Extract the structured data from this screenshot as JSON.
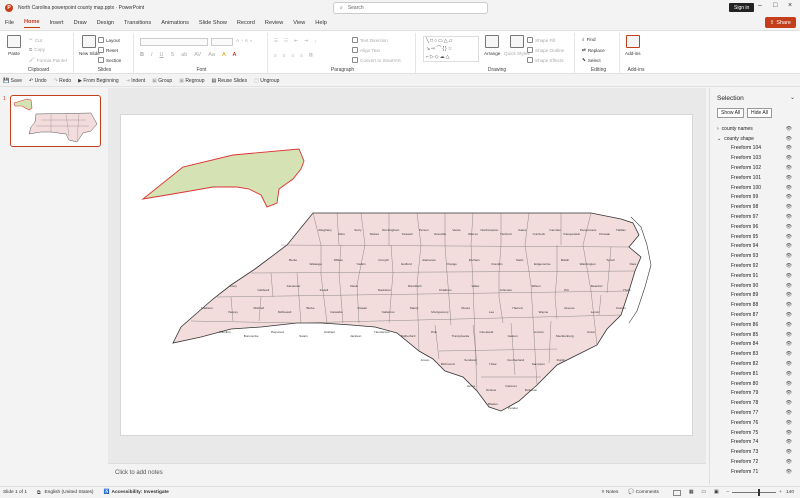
{
  "titlebar": {
    "doc_title": "North Carolina powerpoint county map.pptx  ·  PowerPoint",
    "search_placeholder": "Search",
    "signin": "Sign in"
  },
  "menu": {
    "items": [
      "File",
      "Home",
      "Insert",
      "Draw",
      "Design",
      "Transitions",
      "Animations",
      "Slide Show",
      "Record",
      "Review",
      "View",
      "Help"
    ],
    "share": "Share"
  },
  "ribbon": {
    "clipboard": {
      "label": "Clipboard",
      "paste": "Paste",
      "cut": "Cut",
      "copy": "Copy",
      "format_painter": "Format Painter"
    },
    "slides": {
      "label": "Slides",
      "new_slide": "New Slide",
      "layout": "Layout",
      "reset": "Reset",
      "section": "Section"
    },
    "font": {
      "label": "Font"
    },
    "paragraph": {
      "label": "Paragraph",
      "text_direction": "Text Direction",
      "align_text": "Align Text",
      "smartart": "Convert to SmartArt"
    },
    "drawing": {
      "label": "Drawing",
      "arrange": "Arrange",
      "quick_styles": "Quick Styles",
      "shape_fill": "Shape Fill",
      "shape_outline": "Shape Outline",
      "shape_effects": "Shape Effects"
    },
    "editing": {
      "label": "Editing",
      "find": "Find",
      "replace": "Replace",
      "select": "Select"
    },
    "addins": {
      "label": "Add-ins",
      "addins": "Add-ins"
    }
  },
  "qat": {
    "save": "Save",
    "undo": "Undo",
    "redo": "Redo",
    "from_beginning": "From Beginning",
    "indent": "Indent",
    "group": "Group",
    "regroup": "Regroup",
    "reuse": "Reuse Slides",
    "ungroup": "Ungroup"
  },
  "thumbs": {
    "num": "1"
  },
  "notes": {
    "placeholder": "Click to add notes"
  },
  "selection": {
    "title": "Selection",
    "show_all": "Show All",
    "hide_all": "Hide All",
    "groups": [
      "county names",
      "county shape"
    ],
    "items": [
      "Freeform 104",
      "Freeform 103",
      "Freeform 102",
      "Freeform 101",
      "Freeform 100",
      "Freeform 99",
      "Freeform 98",
      "Freeform 97",
      "Freeform 96",
      "Freeform 95",
      "Freeform 94",
      "Freeform 93",
      "Freeform 92",
      "Freeform 91",
      "Freeform 90",
      "Freeform 89",
      "Freeform 88",
      "Freeform 87",
      "Freeform 86",
      "Freeform 85",
      "Freeform 84",
      "Freeform 83",
      "Freeform 82",
      "Freeform 81",
      "Freeform 80",
      "Freeform 79",
      "Freeform 78",
      "Freeform 77",
      "Freeform 76",
      "Freeform 75",
      "Freeform 74",
      "Freeform 73",
      "Freeform 72",
      "Freeform 71"
    ]
  },
  "status": {
    "slide": "Slide 1 of 1",
    "language": "English (United States)",
    "accessibility": "Accessibility: Investigate",
    "notes": "Notes",
    "comments": "Comments",
    "zoom": "140"
  },
  "colors": {
    "accent": "#c43e1c",
    "county_fill": "#f2dcdc",
    "inset_fill": "#d4e2b4"
  },
  "counties": [
    "Alleghany",
    "Ashe",
    "Surry",
    "Stokes",
    "Rockingham",
    "Caswell",
    "Person",
    "Granville",
    "Vance",
    "Warren",
    "Northampton",
    "Hertford",
    "Gates",
    "Currituck",
    "Camden",
    "Pasquotank",
    "Perquimans",
    "Chowan",
    "Halifax",
    "Bertie",
    "Watauga",
    "Wilkes",
    "Yadkin",
    "Forsyth",
    "Guilford",
    "Alamance",
    "Orange",
    "Durham",
    "Franklin",
    "Nash",
    "Edgecombe",
    "Martin",
    "Washington",
    "Tyrrell",
    "Dare",
    "Avery",
    "Caldwell",
    "Alexander",
    "Iredell",
    "Davie",
    "Davidson",
    "Randolph",
    "Chatham",
    "Wake",
    "Johnston",
    "Wilson",
    "Pitt",
    "Beaufort",
    "Hyde",
    "Madison",
    "Yancey",
    "Mitchell",
    "McDowell",
    "Burke",
    "Catawba",
    "Rowan",
    "Cabarrus",
    "Stanly",
    "Montgomery",
    "Moore",
    "Lee",
    "Harnett",
    "Wayne",
    "Greene",
    "Lenoir",
    "Craven",
    "Pamlico",
    "Buncombe",
    "Haywood",
    "Swain",
    "Graham",
    "Jackson",
    "Henderson",
    "Rutherford",
    "Polk",
    "Transylvania",
    "Cleveland",
    "Gaston",
    "Lincoln",
    "Mecklenburg",
    "Union",
    "Anson",
    "Richmond",
    "Scotland",
    "Hoke",
    "Cumberland",
    "Sampson",
    "Duplin",
    "Jones",
    "Onslow",
    "Carteret",
    "Robeson",
    "Bladen",
    "Pender",
    "Columbus",
    "Brunswick",
    "New Hanover",
    "Cherokee",
    "Clay",
    "Macon"
  ]
}
